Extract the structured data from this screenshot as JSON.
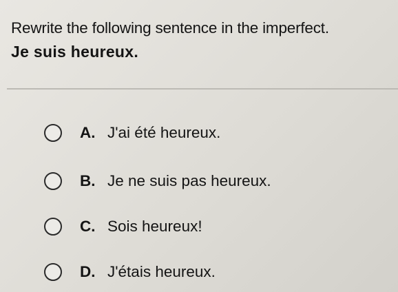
{
  "question": {
    "prompt": "Rewrite the following sentence in the imperfect.",
    "sentence": "Je suis heureux."
  },
  "options": [
    {
      "letter": "A.",
      "text": "J'ai été heureux."
    },
    {
      "letter": "B.",
      "text": "Je ne suis pas heureux."
    },
    {
      "letter": "C.",
      "text": "Sois heureux!"
    },
    {
      "letter": "D.",
      "text": "J'étais heureux."
    }
  ]
}
